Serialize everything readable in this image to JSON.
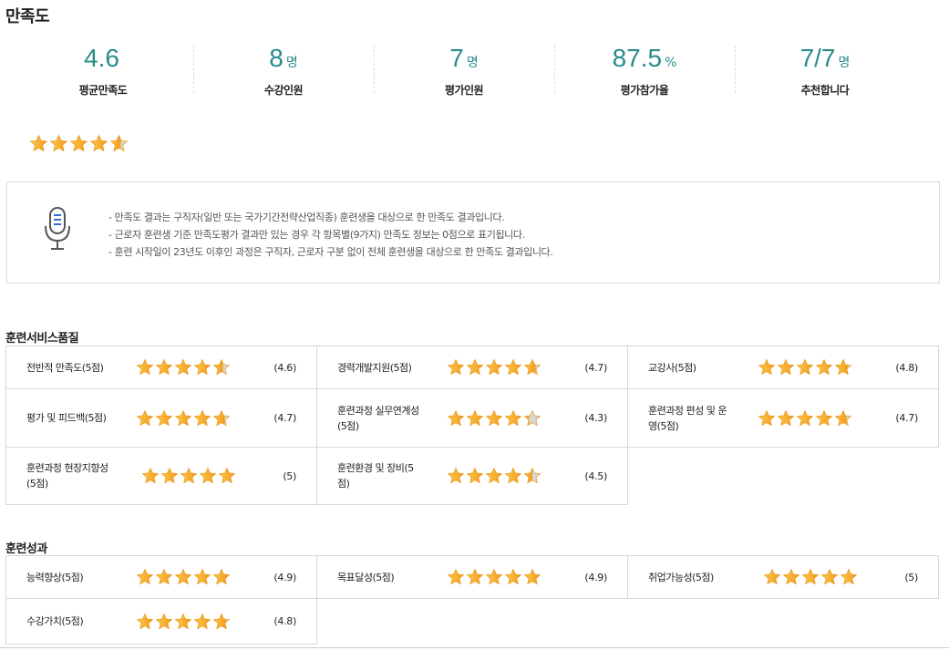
{
  "title": "만족도",
  "stats": [
    {
      "value": "4.6",
      "unit": "",
      "label": "평균만족도"
    },
    {
      "value": "8",
      "unit": "명",
      "label": "수강인원"
    },
    {
      "value": "7",
      "unit": "명",
      "label": "평가인원"
    },
    {
      "value": "87.5",
      "unit": "%",
      "label": "평가참가율"
    },
    {
      "value": "7/7",
      "unit": "명",
      "label": "추천합니다"
    }
  ],
  "overall_rating": 4.6,
  "notice": [
    "- 만족도 결과는 구직자(일반 또는 국가기간전략산업직종) 훈련생을 대상으로 한 만족도 결과입니다.",
    "- 근로자 훈련생 기준 만족도평가 결과만 있는 경우 각 항목별(9가지) 만족도 정보는 0점으로 표기됩니다.",
    "- 훈련 시작일이 23년도 이후인 과정은 구직자, 근로자 구분 없이 전체 훈련생을 대상으로 한 만족도 결과입니다."
  ],
  "sections": [
    {
      "title": "훈련서비스품질",
      "items": [
        {
          "label": "전반적 만족도(5점)",
          "score_text": "(4.6)",
          "rating": 4.6
        },
        {
          "label": "경력개발지원(5점)",
          "score_text": "(4.7)",
          "rating": 4.7
        },
        {
          "label": "교강사(5점)",
          "score_text": "(4.8)",
          "rating": 4.8
        },
        {
          "label": "평가 및 피드백(5점)",
          "score_text": "(4.7)",
          "rating": 4.7
        },
        {
          "label": "훈련과정 실무연계성(5점)",
          "score_text": "(4.3)",
          "rating": 4.3
        },
        {
          "label": "훈련과정 편성 및 운영(5점)",
          "score_text": "(4.7)",
          "rating": 4.7
        },
        {
          "label": "훈련과정 현장지향성(5점)",
          "score_text": "(5)",
          "rating": 5
        },
        {
          "label": "훈련환경 및 장비(5점)",
          "score_text": "(4.5)",
          "rating": 4.5
        }
      ]
    },
    {
      "title": "훈련성과",
      "items": [
        {
          "label": "능력향상(5점)",
          "score_text": "(4.9)",
          "rating": 4.9
        },
        {
          "label": "목표달성(5점)",
          "score_text": "(4.9)",
          "rating": 4.9
        },
        {
          "label": "취업가능성(5점)",
          "score_text": "(5)",
          "rating": 5
        },
        {
          "label": "수강가치(5점)",
          "score_text": "(4.8)",
          "rating": 4.8
        }
      ]
    }
  ],
  "colors": {
    "accent": "#2b8a8a",
    "star_fill": "#f6a623",
    "star_empty": "#d4d4d4"
  },
  "icons": {
    "notice": "microphone-icon",
    "rating": "star-icon"
  }
}
